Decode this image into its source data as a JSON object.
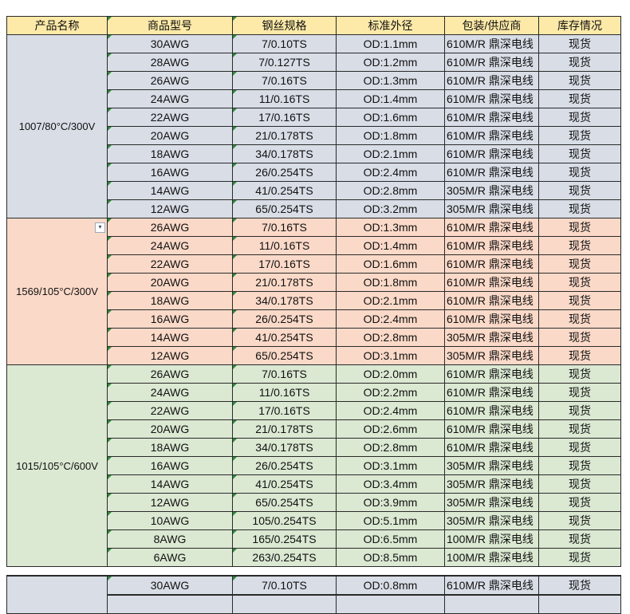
{
  "headers": [
    "产品名称",
    "商品型号",
    "钢丝规格",
    "标准外径",
    "包装/供应商",
    "库存情况"
  ],
  "groups": [
    {
      "name": "1007/80°C/300V",
      "rows": [
        [
          "30AWG",
          "7/0.10TS",
          "OD:1.1mm",
          "610M/R 鼎深电线",
          "现货"
        ],
        [
          "28AWG",
          "7/0.127TS",
          "OD:1.2mm",
          "610M/R 鼎深电线",
          "现货"
        ],
        [
          "26AWG",
          "7/0.16TS",
          "OD:1.3mm",
          "610M/R 鼎深电线",
          "现货"
        ],
        [
          "24AWG",
          "11/0.16TS",
          "OD:1.4mm",
          "610M/R 鼎深电线",
          "现货"
        ],
        [
          "22AWG",
          "17/0.16TS",
          "OD:1.6mm",
          "610M/R 鼎深电线",
          "现货"
        ],
        [
          "20AWG",
          "21/0.178TS",
          "OD:1.8mm",
          "610M/R 鼎深电线",
          "现货"
        ],
        [
          "18AWG",
          "34/0.178TS",
          "OD:2.1mm",
          "610M/R 鼎深电线",
          "现货"
        ],
        [
          "16AWG",
          "26/0.254TS",
          "OD:2.4mm",
          "610M/R 鼎深电线",
          "现货"
        ],
        [
          "14AWG",
          "41/0.254TS",
          "OD:2.8mm",
          "305M/R 鼎深电线",
          "现货"
        ],
        [
          "12AWG",
          "65/0.254TS",
          "OD:3.2mm",
          "305M/R 鼎深电线",
          "现货"
        ]
      ]
    },
    {
      "name": "1569/105°C/300V",
      "rows": [
        [
          "26AWG",
          "7/0.16TS",
          "OD:1.3mm",
          "610M/R 鼎深电线",
          "现货"
        ],
        [
          "24AWG",
          "11/0.16TS",
          "OD:1.4mm",
          "610M/R 鼎深电线",
          "现货"
        ],
        [
          "22AWG",
          "17/0.16TS",
          "OD:1.6mm",
          "610M/R 鼎深电线",
          "现货"
        ],
        [
          "20AWG",
          "21/0.178TS",
          "OD:1.8mm",
          "610M/R 鼎深电线",
          "现货"
        ],
        [
          "18AWG",
          "34/0.178TS",
          "OD:2.1mm",
          "610M/R 鼎深电线",
          "现货"
        ],
        [
          "16AWG",
          "26/0.254TS",
          "OD:2.4mm",
          "610M/R 鼎深电线",
          "现货"
        ],
        [
          "14AWG",
          "41/0.254TS",
          "OD:2.8mm",
          "305M/R 鼎深电线",
          "现货"
        ],
        [
          "12AWG",
          "65/0.254TS",
          "OD:3.1mm",
          "305M/R 鼎深电线",
          "现货"
        ]
      ]
    },
    {
      "name": "1015/105°C/600V",
      "rows": [
        [
          "26AWG",
          "7/0.16TS",
          "OD:2.0mm",
          "610M/R 鼎深电线",
          "现货"
        ],
        [
          "24AWG",
          "11/0.16TS",
          "OD:2.2mm",
          "610M/R 鼎深电线",
          "现货"
        ],
        [
          "22AWG",
          "17/0.16TS",
          "OD:2.4mm",
          "610M/R 鼎深电线",
          "现货"
        ],
        [
          "20AWG",
          "21/0.178TS",
          "OD:2.6mm",
          "610M/R 鼎深电线",
          "现货"
        ],
        [
          "18AWG",
          "34/0.178TS",
          "OD:2.8mm",
          "610M/R 鼎深电线",
          "现货"
        ],
        [
          "16AWG",
          "26/0.254TS",
          "OD:3.1mm",
          "305M/R 鼎深电线",
          "现货"
        ],
        [
          "14AWG",
          "41/0.254TS",
          "OD:3.4mm",
          "305M/R 鼎深电线",
          "现货"
        ],
        [
          "12AWG",
          "65/0.254TS",
          "OD:3.9mm",
          "305M/R 鼎深电线",
          "现货"
        ],
        [
          "10AWG",
          "105/0.254TS",
          "OD:5.1mm",
          "305M/R 鼎深电线",
          "现货"
        ],
        [
          "8AWG",
          "165/0.254TS",
          "OD:6.5mm",
          "100M/R 鼎深电线",
          "现货"
        ],
        [
          "6AWG",
          "263/0.254TS",
          "OD:8.5mm",
          "100M/R 鼎深电线",
          "现货"
        ]
      ]
    }
  ],
  "partial_group": {
    "rows": [
      [
        "30AWG",
        "7/0.10TS",
        "OD:0.8mm",
        "610M/R 鼎深电线",
        "现货"
      ]
    ]
  },
  "colors": {
    "header_bg": "#fdeaa8",
    "group1_bg": "#d8dde6",
    "group2_bg": "#fbd9c8",
    "group3_bg": "#dbe8d2",
    "comment_marker": "#2d8a3a"
  },
  "icons": {
    "filter": "filter-dropdown-icon"
  }
}
